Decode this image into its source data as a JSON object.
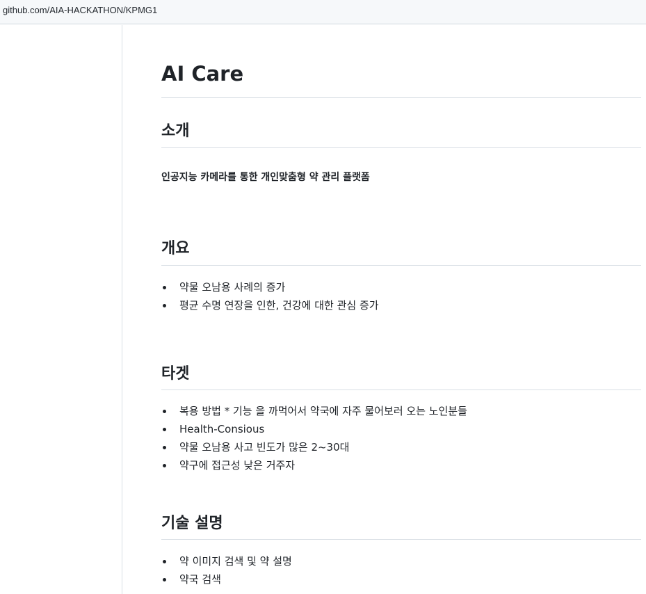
{
  "browser": {
    "url": "github.com/AIA-HACKATHON/KPMG1"
  },
  "readme": {
    "title": "AI Care",
    "sections": [
      {
        "heading": "소개",
        "bold_text": "인공지능 카메라를 통한 개인맞춤형 약 관리 플랫폼"
      },
      {
        "heading": "개요",
        "items": [
          "약물 오남용 사례의 증가",
          "평균 수명 연장을 인한, 건강에 대한 관심 증가"
        ]
      },
      {
        "heading": "타겟",
        "items": [
          "복용 방법 * 기능 을 까먹어서 약국에 자주 물어보러 오는 노인분들",
          "Health-Consious",
          "약물 오남용 사고 빈도가 많은 2~30대",
          "약구에 접근성 낮은 거주자"
        ]
      },
      {
        "heading": "기술 설명",
        "items": [
          "약 이미지 검색 및 약 설명",
          "약국 검색"
        ]
      }
    ]
  }
}
